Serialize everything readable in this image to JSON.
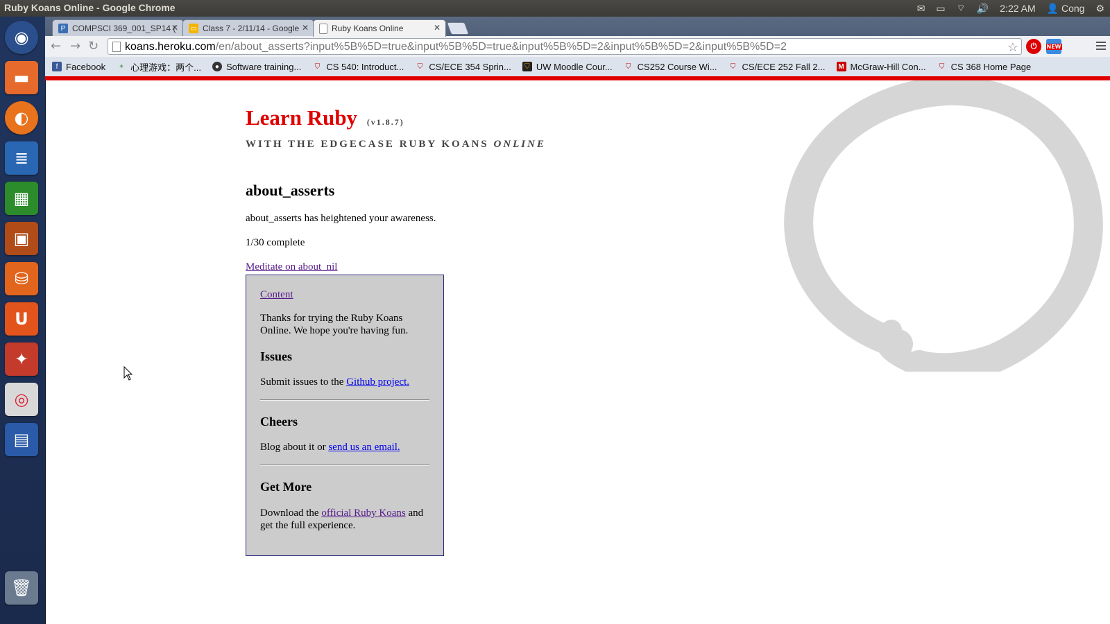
{
  "system": {
    "window_title": "Ruby Koans Online - Google Chrome",
    "clock": "2:22 AM",
    "user": "Cong"
  },
  "tabs": [
    {
      "label": "COMPSCI 369_001_SP14 (",
      "icon": "p-icon",
      "active": false
    },
    {
      "label": "Class 7 - 2/11/14 - Google",
      "icon": "slides-icon",
      "active": false
    },
    {
      "label": "Ruby Koans Online",
      "icon": "page-icon",
      "active": true
    }
  ],
  "address": {
    "host": "koans.heroku.com",
    "path": "/en/about_asserts?input%5B%5D=true&input%5B%5D=true&input%5B%5D=2&input%5B%5D=2&input%5B%5D=2"
  },
  "extensions": {
    "new_badge": "NEW"
  },
  "bookmarks": [
    {
      "label": "Facebook",
      "icon": "facebook-icon"
    },
    {
      "label": "心理游戏：两个...",
      "icon": "bookmark-icon"
    },
    {
      "label": "Software training...",
      "icon": "tutorial-icon"
    },
    {
      "label": "CS 540: Introduct...",
      "icon": "uw-crest-icon"
    },
    {
      "label": "CS/ECE 354 Sprin...",
      "icon": "uw-crest-icon"
    },
    {
      "label": "UW Moodle Cour...",
      "icon": "moodle-icon"
    },
    {
      "label": "CS252 Course Wi...",
      "icon": "uw-crest-icon"
    },
    {
      "label": "CS/ECE 252 Fall 2...",
      "icon": "uw-crest-icon"
    },
    {
      "label": "McGraw-Hill Con...",
      "icon": "mcgraw-icon"
    },
    {
      "label": "CS 368 Home Page",
      "icon": "uw-crest-icon"
    }
  ],
  "page": {
    "logo_title": "Learn Ruby",
    "version": "(v1.8.7)",
    "tagline_main": "WITH THE EDGECASE RUBY KOANS ",
    "tagline_em": "ONLINE",
    "koan_heading": "about_asserts",
    "message": "about_asserts has heightened your awareness.",
    "progress_text": "1/30 complete",
    "meditate_link": "Meditate on about_nil"
  },
  "sidebar": {
    "content_link": "Content",
    "thanks": "Thanks for trying the Ruby Koans Online. We hope you're having fun.",
    "issues_heading": "Issues",
    "issues_text": "Submit issues to the ",
    "issues_link": "Github project.",
    "cheers_heading": "Cheers",
    "cheers_text": "Blog about it or ",
    "cheers_link": "send us an email.",
    "more_heading": "Get More",
    "more_text_1": "Download the ",
    "more_link": "official Ruby Koans",
    "more_text_2": " and get the full experience."
  },
  "colors": {
    "logo_red": "#e00000",
    "sidebar_bg": "#cccccc",
    "link_blue": "#0000ee",
    "link_visited": "#551a8b"
  }
}
